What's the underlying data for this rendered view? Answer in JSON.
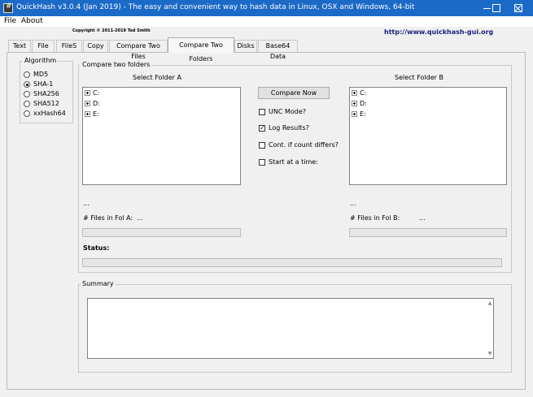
{
  "window": {
    "title": "QuickHash v3.0.4 (Jan 2019) - The easy and convenient way to hash data in Linux, OSX and Windows, 64-bit",
    "icon": "hash-app-icon",
    "controls": {
      "minimize": "minimize-icon",
      "maximize": "maximize-icon",
      "close": "close-icon"
    }
  },
  "menu": {
    "items": [
      "File",
      "About"
    ]
  },
  "header": {
    "copyright": "Copyright © 2011-2019  Ted Smith",
    "url": "http://www.quickhash-gui.org",
    "url_color": "#1b1b80"
  },
  "tabs": [
    {
      "label": "Text",
      "active": false
    },
    {
      "label": "File",
      "active": false
    },
    {
      "label": "FileS",
      "active": false
    },
    {
      "label": "Copy",
      "active": false
    },
    {
      "label": "Compare Two Files",
      "active": false
    },
    {
      "label": "Compare Two Folders",
      "active": true
    },
    {
      "label": "Disks",
      "active": false
    },
    {
      "label": "Base64 Data",
      "active": false
    }
  ],
  "algorithm": {
    "title": "Algorithm",
    "options": [
      {
        "label": "MD5",
        "selected": false
      },
      {
        "label": "SHA-1",
        "selected": true
      },
      {
        "label": "SHA256",
        "selected": false
      },
      {
        "label": "SHA512",
        "selected": false
      },
      {
        "label": "xxHash64",
        "selected": false
      }
    ]
  },
  "compare": {
    "title": "Compare two folders",
    "folder_a": {
      "title": "Select Folder A",
      "drives": [
        "C:",
        "D:",
        "E:"
      ],
      "path": "...",
      "count_label": "# Files in Fol A:",
      "count_value": "..."
    },
    "folder_b": {
      "title": "Select Folder B",
      "drives": [
        "C:",
        "D:",
        "E:"
      ],
      "path": "...",
      "count_label": "# Files in Fol B:",
      "count_value": "..."
    },
    "compare_button": "Compare Now",
    "options": [
      {
        "label": "UNC Mode?",
        "checked": false
      },
      {
        "label": "Log Results?",
        "checked": true
      },
      {
        "label": "Cont. if count differs?",
        "checked": false
      },
      {
        "label": "Start at a time:",
        "checked": false
      }
    ],
    "status_label": "Status:"
  },
  "summary": {
    "title": "Summary",
    "text": ""
  },
  "colors": {
    "titlebar": "#1c6ac8",
    "window_bg": "#f0f0f0",
    "titlebar_text": "#ffffff"
  }
}
